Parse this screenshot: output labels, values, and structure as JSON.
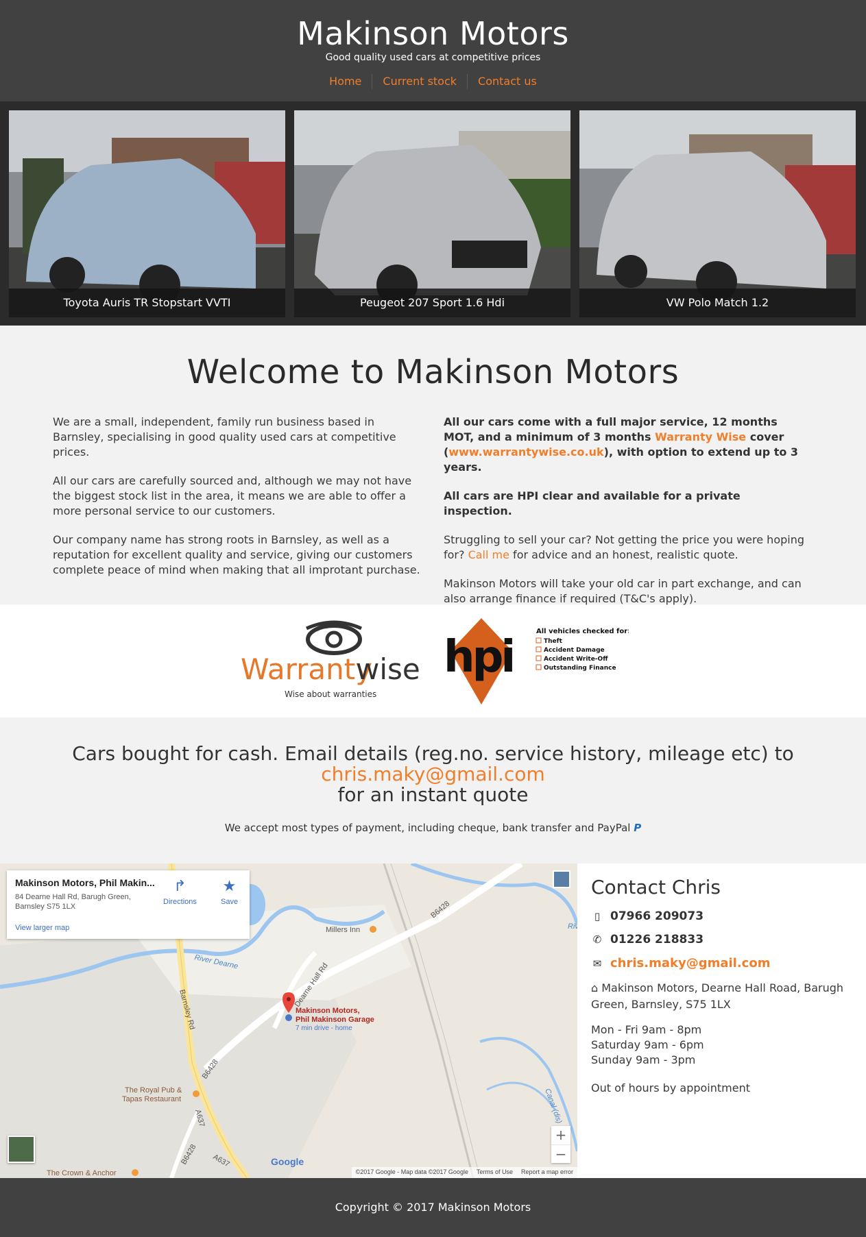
{
  "header": {
    "title": "Makinson Motors",
    "tagline": "Good quality used cars at competitive prices",
    "nav": [
      {
        "label": "Home"
      },
      {
        "label": "Current stock"
      },
      {
        "label": "Contact us"
      }
    ]
  },
  "gallery": [
    {
      "caption": "Toyota Auris TR Stopstart VVTI"
    },
    {
      "caption": "Peugeot 207 Sport 1.6 Hdi"
    },
    {
      "caption": "VW Polo Match 1.2"
    }
  ],
  "welcome": {
    "title": "Welcome to Makinson Motors",
    "left": [
      "We are a small, independent, family run business based in Barnsley, specialising in good quality used cars at competitive prices.",
      "All our cars are carefully sourced and, although we may not have the biggest stock list in the area, it means we are able to offer a more personal service to our customers.",
      "Our company name has strong roots in Barnsley, as well as a reputation for excellent quality and service, giving our customers complete peace of mind when making that all improtant purchase."
    ],
    "right": {
      "p1_before": "All our cars come with a full major service, 12 months MOT, and a minimum of 3 months ",
      "p1_link": "Warranty Wise",
      "p1_mid": " cover (",
      "p1_url": "www.warrantywise.co.uk",
      "p1_after": "), with option to extend up to 3 years.",
      "p2": "All cars are HPI clear and available for a private inspection.",
      "p3_before": "Struggling to sell your car? Not getting the price you were hoping for? ",
      "p3_link": "Call me",
      "p3_after": " for advice and an honest, realistic quote.",
      "p4": "Makinson Motors will take your old car in part exchange, and can also arrange finance if required (T&C's apply)."
    }
  },
  "logos": {
    "warranty_brand": "Warrantywise",
    "warranty_part1": "Warranty",
    "warranty_part2": "wise",
    "warranty_tagline": "Wise about warranties",
    "hpi_brand": "hpi",
    "hpi_heading": "All vehicles checked for:",
    "hpi_checks": [
      "Theft",
      "Accident Damage",
      "Accident Write-Off",
      "Outstanding Finance"
    ]
  },
  "cash": {
    "line1": "Cars bought for cash. Email details (reg.no. service history, mileage etc) to",
    "email": "chris.maky@gmail.com",
    "line3": "for an instant quote",
    "payment": "We accept most types of payment, including cheque, bank transfer and PayPal"
  },
  "map": {
    "place_name": "Makinson Motors, Phil Makin...",
    "address": "84 Dearne Hall Rd, Barugh Green, Barnsley S75 1LX",
    "directions_label": "Directions",
    "save_label": "Save",
    "larger_map_label": "View larger map",
    "pin_label_line1": "Makinson Motors,",
    "pin_label_line2": "Phil Makinson Garage",
    "pin_sub": "7 min drive - home",
    "labels": {
      "millers_inn": "Millers Inn",
      "river_dearne": "River Dearne",
      "dearne_hall_rd": "Dearne Hall Rd",
      "barnsley_rd": "Barnsley Rd",
      "b6428_a": "B6428",
      "b6428_b": "B6428",
      "b6428_c": "B6428",
      "a637_a": "A637",
      "a637_b": "A637",
      "royal_pub_1": "The Royal Pub &",
      "royal_pub_2": "Tapas Restaurant",
      "crown_anchor": "The Crown & Anchor",
      "canal": "Canal (dis)",
      "river_right": "Riv"
    },
    "zoom_in": "+",
    "zoom_out": "−",
    "google": "Google",
    "attribution": "©2017 Google - Map data ©2017 Google",
    "terms": "Terms of Use",
    "report": "Report a map error"
  },
  "contact": {
    "heading": "Contact Chris",
    "mobile": "07966 209073",
    "phone": "01226 218833",
    "email": "chris.maky@gmail.com",
    "address": "Makinson Motors, Dearne Hall Road, Barugh Green, Barnsley, S75 1LX",
    "hours": [
      "Mon - Fri 9am - 8pm",
      "Saturday 9am - 6pm",
      "Sunday 9am - 3pm"
    ],
    "out_of_hours": "Out of hours by appointment"
  },
  "footer": {
    "copyright": "Copyright © 2017 Makinson Motors"
  },
  "colors": {
    "accent": "#f07e2a",
    "header_bg": "#414141",
    "gallery_bg": "#2b2b2b"
  }
}
